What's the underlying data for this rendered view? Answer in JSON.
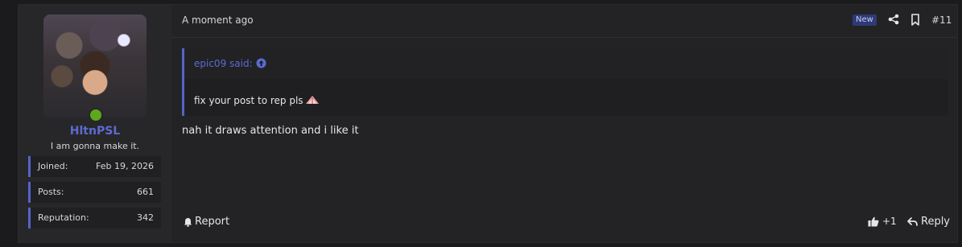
{
  "user": {
    "username": "HltnPSL",
    "title": "I am gonna make it.",
    "stats": [
      {
        "label": "Joined:",
        "value": "Feb 19, 2026"
      },
      {
        "label": "Posts:",
        "value": "661"
      },
      {
        "label": "Reputation:",
        "value": "342"
      }
    ],
    "online_color": "#5ea91b"
  },
  "post": {
    "time": "A moment ago",
    "new_badge": "New",
    "number": "#11",
    "quote": {
      "author": "epic09 said:",
      "text": "fix your post to rep pls"
    },
    "body": "nah it draws attention and i like it"
  },
  "actions": {
    "report": "Report",
    "like_count": "+1",
    "reply": "Reply"
  },
  "colors": {
    "accent": "#5b6bd1",
    "background": "#1b1b1d",
    "panel": "#232325"
  }
}
